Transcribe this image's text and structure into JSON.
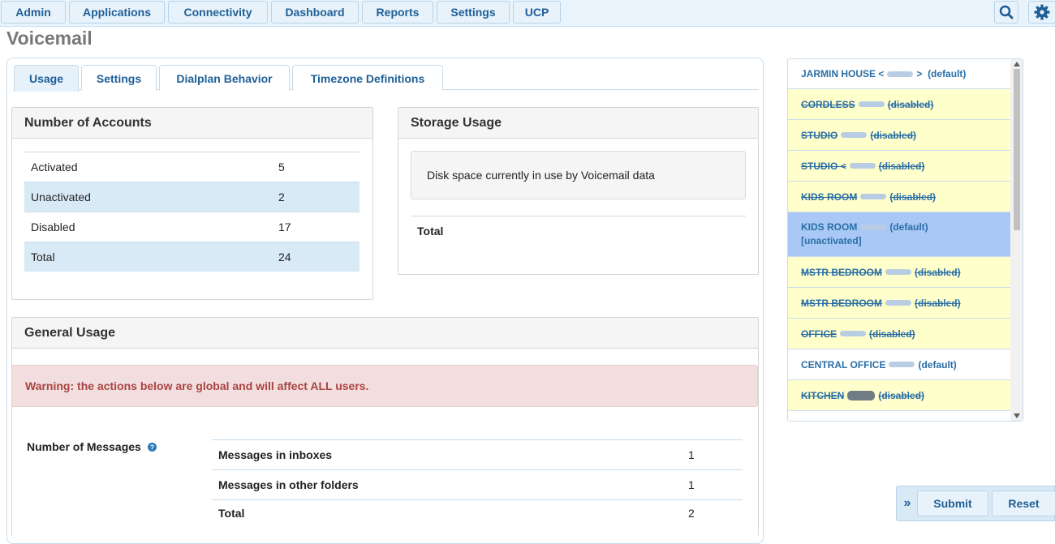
{
  "nav": {
    "items": [
      "Admin",
      "Applications",
      "Connectivity",
      "Dashboard",
      "Reports",
      "Settings",
      "UCP"
    ]
  },
  "page_title": "Voicemail",
  "tabs": [
    "Usage",
    "Settings",
    "Dialplan Behavior",
    "Timezone Definitions"
  ],
  "accounts": {
    "title": "Number of Accounts",
    "rows": [
      {
        "label": "Activated",
        "value": "5"
      },
      {
        "label": "Unactivated",
        "value": "2"
      },
      {
        "label": "Disabled",
        "value": "17"
      },
      {
        "label": "Total",
        "value": "24"
      }
    ]
  },
  "storage": {
    "title": "Storage Usage",
    "info": "Disk space currently in use by Voicemail data",
    "total_label": "Total"
  },
  "general": {
    "title": "General Usage",
    "warning": "Warning: the actions below are global and will affect ALL users.",
    "messages_label": "Number of Messages",
    "rows": [
      {
        "label": "Messages in inboxes",
        "value": "1"
      },
      {
        "label": "Messages in other folders",
        "value": "1"
      },
      {
        "label": "Total",
        "value": "2"
      }
    ]
  },
  "extension_list": [
    {
      "name": "JARMIN HOUSE",
      "pre": "<",
      "post": ">",
      "status": "(default)",
      "state": "normal"
    },
    {
      "name": "CORDLESS",
      "pre": "",
      "post": "",
      "status": "(disabled)",
      "state": "disabled"
    },
    {
      "name": "STUDIO",
      "pre": "",
      "post": "",
      "status": "(disabled)",
      "state": "disabled"
    },
    {
      "name": "STUDIO",
      "pre": "<",
      "post": "",
      "status": "(disabled)",
      "state": "disabled"
    },
    {
      "name": "KIDS ROOM",
      "pre": "",
      "post": "",
      "status": "(disabled)",
      "state": "disabled"
    },
    {
      "name": "KIDS ROOM",
      "pre": "",
      "post": "",
      "status": "(default)",
      "extra": "[unactivated]",
      "state": "selected"
    },
    {
      "name": "MSTR BEDROOM",
      "pre": "",
      "post": "",
      "status": "(disabled)",
      "state": "disabled"
    },
    {
      "name": "MSTR BEDROOM",
      "pre": "",
      "post": "",
      "status": "(disabled)",
      "state": "disabled"
    },
    {
      "name": "OFFICE",
      "pre": "",
      "post": "",
      "status": "(disabled)",
      "state": "disabled"
    },
    {
      "name": "CENTRAL OFFICE",
      "pre": "",
      "post": "",
      "status": "(default)",
      "state": "normal"
    },
    {
      "name": "KITCHEN",
      "pre": "",
      "post": "",
      "status": "(disabled)",
      "state": "disabled"
    }
  ],
  "actions": {
    "expand_icon": "»",
    "submit": "Submit",
    "reset": "Reset"
  },
  "icons": {
    "search": "search-icon",
    "settings": "gear-icon",
    "help": "question-icon"
  }
}
